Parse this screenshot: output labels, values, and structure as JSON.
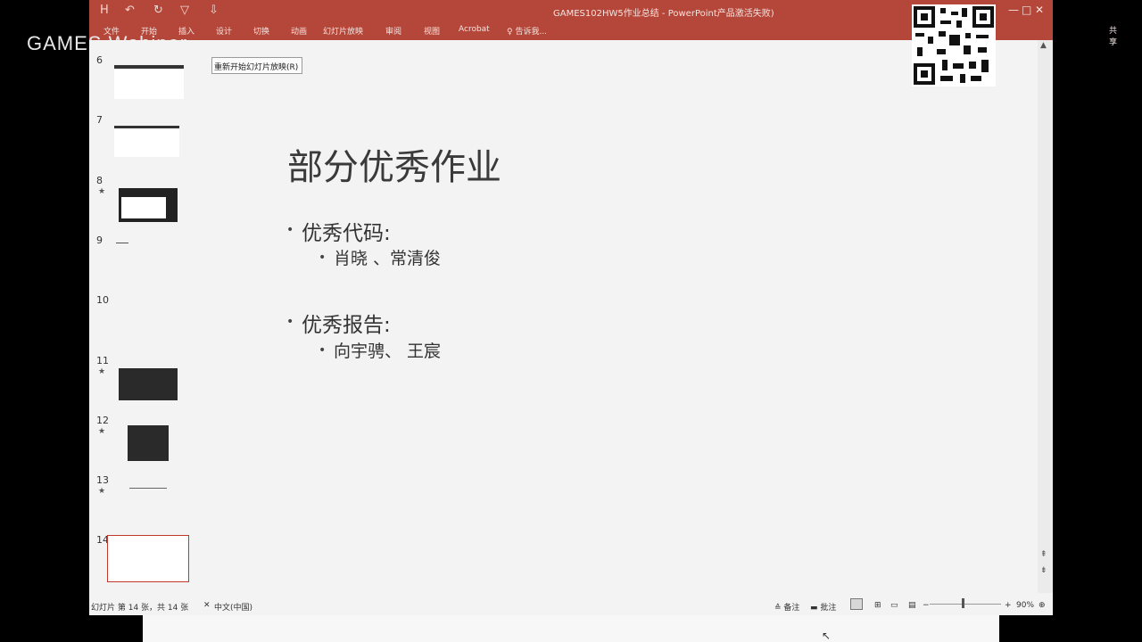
{
  "window": {
    "title": "GAMES102HW5作业总结 - PowerPoint产品激活失败)",
    "quick_access": [
      "H",
      "↶",
      "↻",
      "▽",
      "⇩"
    ],
    "controls": {
      "minimize": "—",
      "maximize": "□",
      "close": "✕"
    },
    "tabs": [
      "文件",
      "开始",
      "插入",
      "设计",
      "切换",
      "动画",
      "幻灯片放映",
      "审阅",
      "视图",
      "Acrobat",
      "♀ 告诉我...",
      ""
    ],
    "share": "共享"
  },
  "watermark": "GAMES Webinar",
  "tooltip": "重新开始幻灯片放映(R)",
  "thumbnails": [
    {
      "num": "6",
      "star": ""
    },
    {
      "num": "7",
      "star": ""
    },
    {
      "num": "8",
      "star": "★"
    },
    {
      "num": "9",
      "star": ""
    },
    {
      "num": "10",
      "star": ""
    },
    {
      "num": "11",
      "star": "★"
    },
    {
      "num": "12",
      "star": "★"
    },
    {
      "num": "13",
      "star": "★"
    },
    {
      "num": "14",
      "star": ""
    }
  ],
  "slide": {
    "title": "部分优秀作业",
    "sections": [
      {
        "heading": "优秀代码:",
        "item": "肖晓 、常清俊"
      },
      {
        "heading": "优秀报告:",
        "item": "向宇骋、 王宸"
      }
    ],
    "bullet": "•"
  },
  "status": {
    "slide_info": "幻灯片 第 14 张，共 14 张",
    "language": "中文(中国)",
    "notes": "≙ 备注",
    "comments": "▬ 批注",
    "zoom_minus": "−",
    "zoom_plus": "+",
    "zoom": "90%"
  }
}
